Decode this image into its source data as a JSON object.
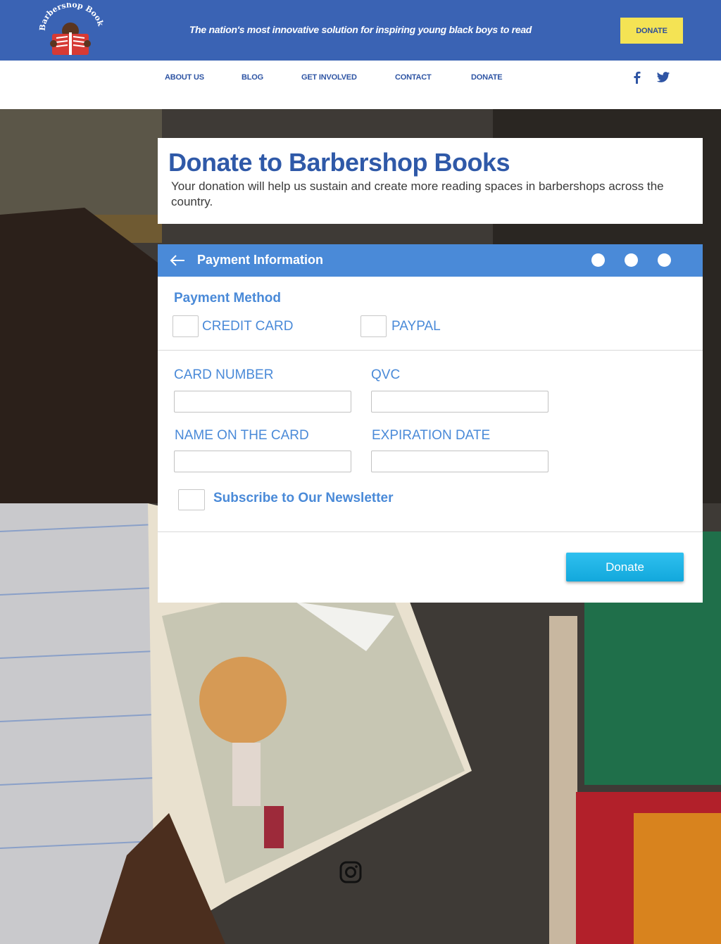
{
  "header": {
    "logo_text": "Barbershop Books",
    "tagline": "The nation's most innovative solution for inspiring young black boys to read",
    "donate_label": "DONATE"
  },
  "nav": {
    "items": [
      {
        "label": "ABOUT US"
      },
      {
        "label": "BLOG"
      },
      {
        "label": "GET INVOLVED"
      },
      {
        "label": "CONTACT"
      },
      {
        "label": "DONATE"
      }
    ],
    "social": [
      "facebook-icon",
      "twitter-icon"
    ]
  },
  "intro": {
    "title": "Donate to Barbershop Books",
    "subtitle": "Your donation will help us sustain and create more reading spaces in barbershops across the country."
  },
  "form": {
    "header_title": "Payment Information",
    "steps": 3,
    "payment_method_label": "Payment Method",
    "options": [
      {
        "label": "CREDIT CARD",
        "checked": false
      },
      {
        "label": "PAYPAL",
        "checked": false
      }
    ],
    "fields": {
      "card_number": {
        "label": "CARD NUMBER",
        "value": ""
      },
      "qvc": {
        "label": "QVC",
        "value": ""
      },
      "name_on_card": {
        "label": "NAME ON THE CARD",
        "value": ""
      },
      "expiration": {
        "label": "EXPIRATION DATE",
        "value": ""
      }
    },
    "newsletter_label": "Subscribe to Our Newsletter",
    "submit_label": "Donate"
  },
  "colors": {
    "brand_blue": "#3a63b4",
    "accent_blue": "#4a8ad8",
    "donate_yellow": "#f4e354",
    "submit_cyan": "#1cb4e6"
  }
}
